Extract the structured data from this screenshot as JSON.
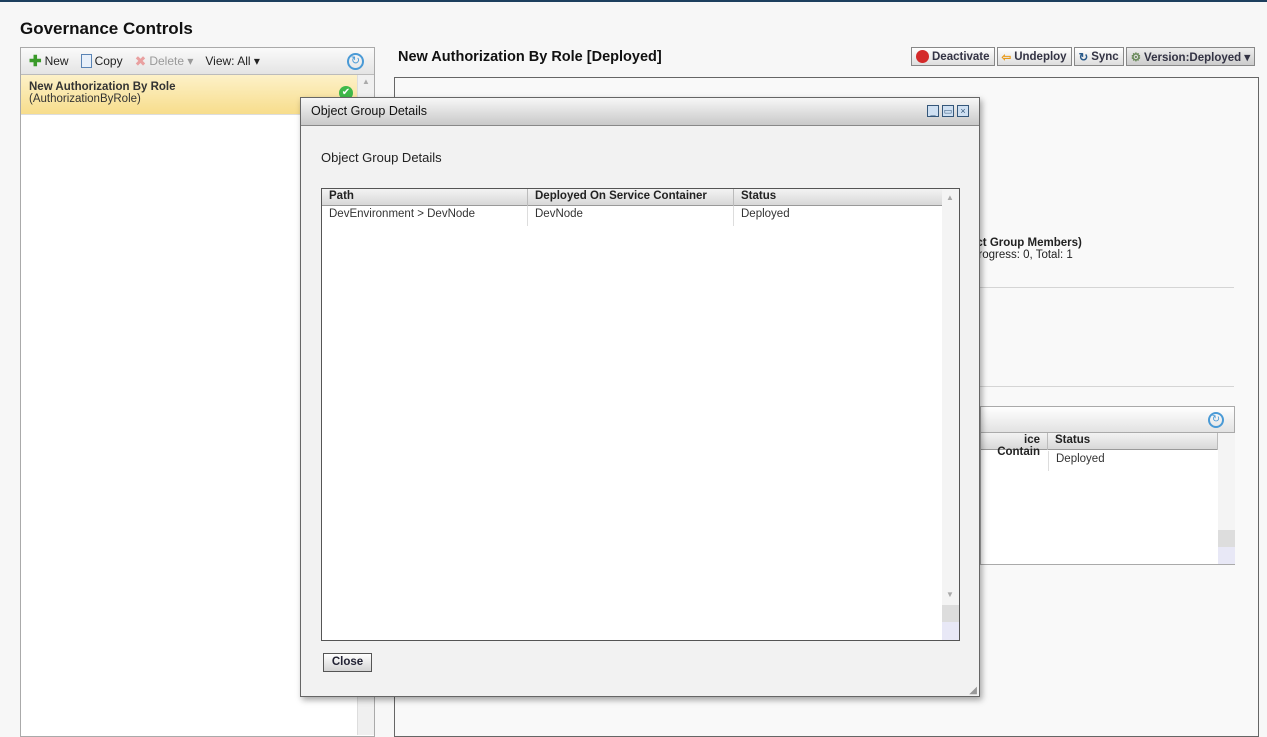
{
  "page_title": "Governance Controls",
  "left_panel": {
    "toolbar": {
      "new": "New",
      "copy": "Copy",
      "delete": "Delete ▾",
      "view": "View: All ▾"
    },
    "items": [
      {
        "name": "New Authorization By Role",
        "type": "(AuthorizationByRole)",
        "status": "deployed"
      }
    ]
  },
  "main": {
    "title": "New Authorization By Role [Deployed]",
    "actions": {
      "deactivate": "Deactivate",
      "undeploy": "Undeploy",
      "sync": "Sync",
      "version": "Version:Deployed ▾"
    },
    "members_label": "ect Group Members)",
    "progress_text": "progress: 0, Total: 1",
    "subgrid": {
      "columns": [
        "ice Contain",
        "Status"
      ],
      "rows": [
        [
          "",
          "Deployed"
        ]
      ]
    }
  },
  "dialog": {
    "title": "Object Group Details",
    "heading": "Object Group Details",
    "columns": [
      "Path",
      "Deployed On Service Container",
      "Status"
    ],
    "rows": [
      [
        "DevEnvironment > DevNode",
        "DevNode",
        "Deployed"
      ]
    ],
    "close": "Close"
  },
  "colors": {
    "accent": "#1d3f5e",
    "selected_item": "#f7dd8c"
  }
}
